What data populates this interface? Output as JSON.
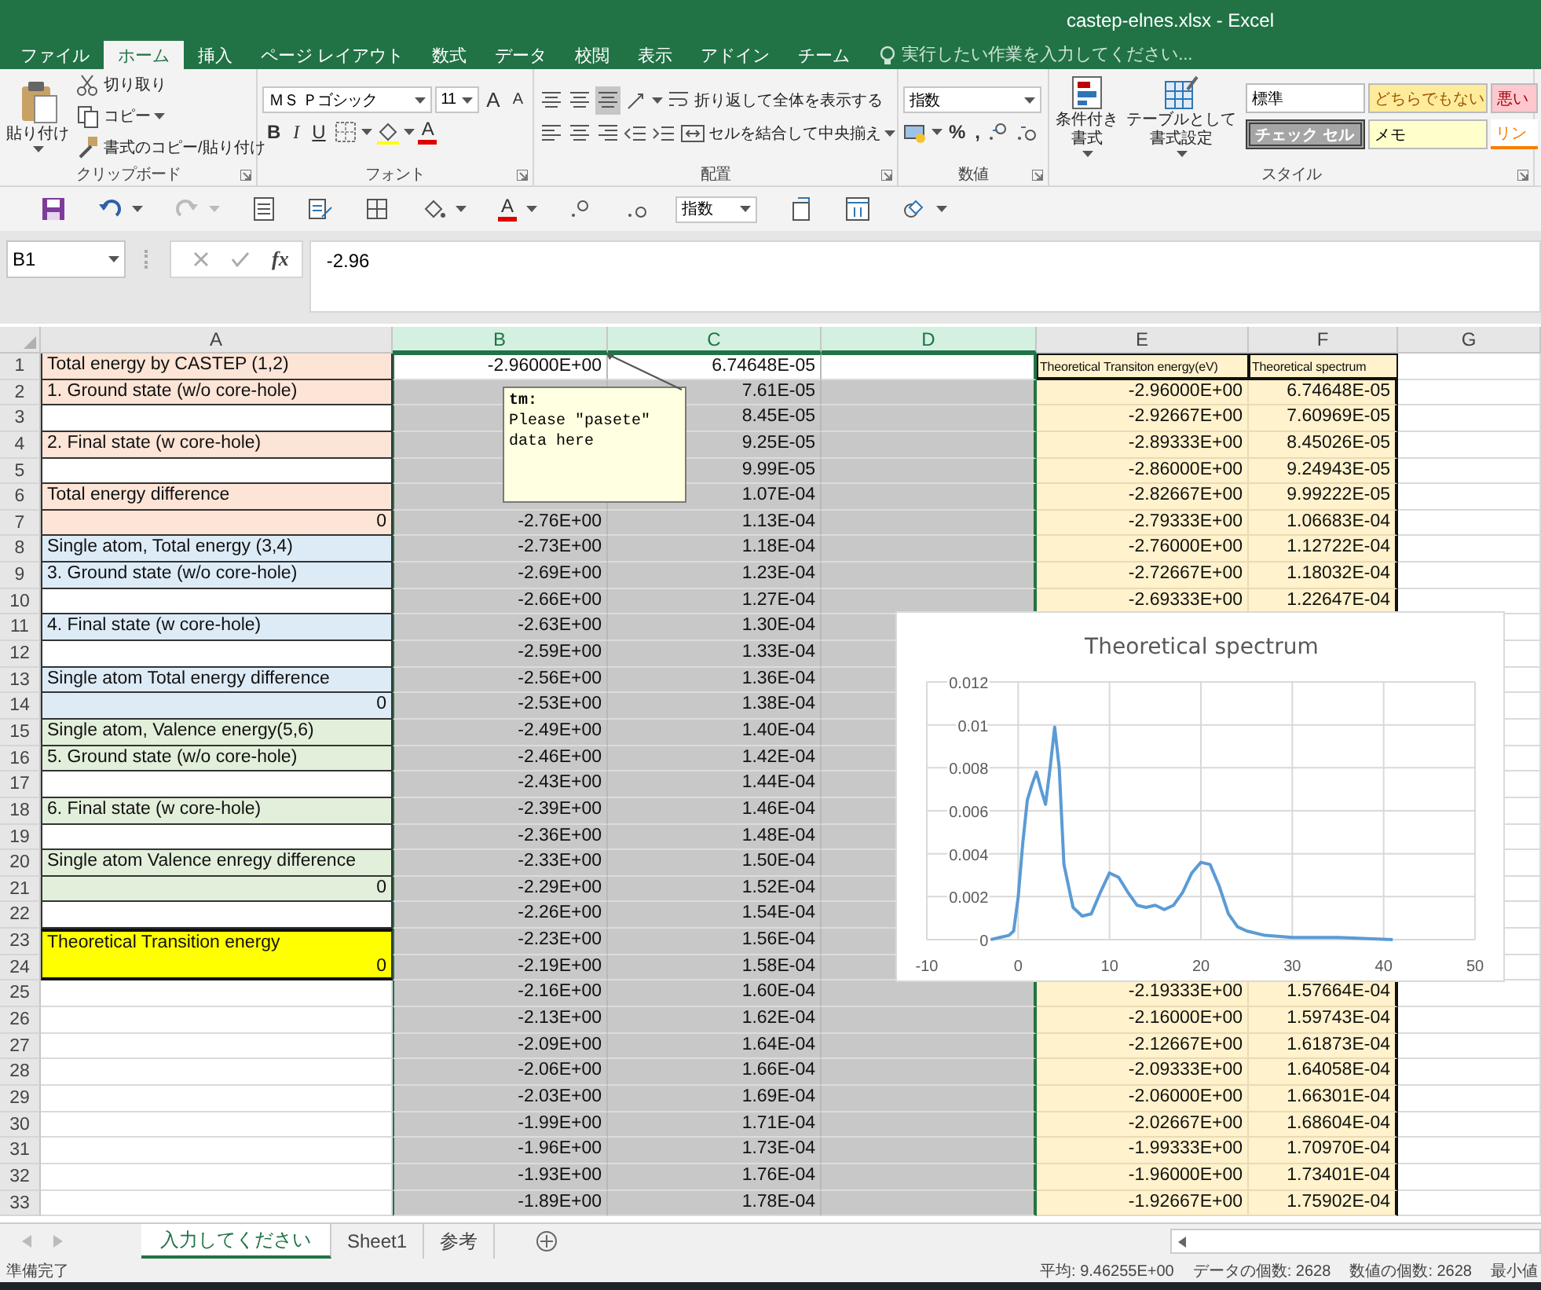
{
  "window": {
    "title": "castep-elnes.xlsx - Excel"
  },
  "ribbon_tabs": [
    {
      "label": "ファイル",
      "selected": false
    },
    {
      "label": "ホーム",
      "selected": true
    },
    {
      "label": "挿入",
      "selected": false
    },
    {
      "label": "ページ レイアウト",
      "selected": false
    },
    {
      "label": "数式",
      "selected": false
    },
    {
      "label": "データ",
      "selected": false
    },
    {
      "label": "校閲",
      "selected": false
    },
    {
      "label": "表示",
      "selected": false
    },
    {
      "label": "アドイン",
      "selected": false
    },
    {
      "label": "チーム",
      "selected": false
    }
  ],
  "tell_me": {
    "placeholder": "実行したい作業を入力してください..."
  },
  "ribbon": {
    "clipboard": {
      "label": "クリップボード",
      "paste": "貼り付け",
      "cut": "切り取り",
      "copy": "コピー",
      "format_painter": "書式のコピー/貼り付け"
    },
    "font": {
      "label": "フォント",
      "name": "ＭＳ Ｐゴシック",
      "size": "11",
      "grow": "A",
      "shrink": "A",
      "bold": "B",
      "italic": "I",
      "underline": "U",
      "font_color": "A"
    },
    "alignment": {
      "label": "配置",
      "wrap": "折り返して全体を表示する",
      "merge": "セルを結合して中央揃え"
    },
    "number": {
      "label": "数値",
      "format": "指数",
      "percent": "%",
      "comma": ","
    },
    "styles": {
      "label": "スタイル",
      "conditional": [
        "条件付き",
        "書式"
      ],
      "table": [
        "テーブルとして",
        "書式設定"
      ],
      "cell_styles": [
        {
          "label": "標準",
          "kind": "normal"
        },
        {
          "label": "どちらでもない",
          "kind": "neutral"
        },
        {
          "label": "悪い",
          "kind": "bad"
        },
        {
          "label": "チェック セル",
          "kind": "check"
        },
        {
          "label": "メモ",
          "kind": "note"
        },
        {
          "label": "リン",
          "kind": "link"
        }
      ]
    }
  },
  "quick_access": {
    "font_color": "A",
    "format": "指数"
  },
  "formula_bar": {
    "name_box": "B1",
    "fx": "fx",
    "value": "-2.96"
  },
  "sheet": {
    "columns": [
      {
        "label": "A",
        "selected": false
      },
      {
        "label": "B",
        "selected": true
      },
      {
        "label": "C",
        "selected": true
      },
      {
        "label": "D",
        "selected": true
      },
      {
        "label": "E",
        "selected": false,
        "color": "#fff2cc"
      },
      {
        "label": "F",
        "selected": false,
        "color": "#fff2cc"
      },
      {
        "label": "G",
        "selected": false
      }
    ],
    "rows": [
      {
        "label": "1",
        "kind": "label",
        "color": "#fce4d6",
        "a": "Total energy by CASTEP (1,2)",
        "b": "-2.96000E+00",
        "c": "6.74648E-05",
        "e": "Theoretical Transiton energy(eV)",
        "f": "Theoretical spectrum",
        "active": true
      },
      {
        "label": "2",
        "kind": "label",
        "color": "#fce4d6",
        "a": "1. Ground state (w/o core-hole)",
        "c": "7.61E-05",
        "e": "-2.96000E+00",
        "f": "6.74648E-05",
        "active": false
      },
      {
        "label": "3",
        "kind": "label",
        "color": "#ffffff",
        "c": "8.45E-05",
        "e": "-2.92667E+00",
        "f": "7.60969E-05",
        "active": false
      },
      {
        "label": "4",
        "kind": "label",
        "color": "#fce4d6",
        "a": "2. Final state (w core-hole)",
        "c": "9.25E-05",
        "e": "-2.89333E+00",
        "f": "8.45026E-05",
        "active": false
      },
      {
        "label": "5",
        "kind": "label",
        "color": "#ffffff",
        "c": "9.99E-05",
        "e": "-2.86000E+00",
        "f": "9.24943E-05",
        "active": false
      },
      {
        "label": "6",
        "kind": "label",
        "color": "#fce4d6",
        "a": "Total energy difference",
        "c": "1.07E-04",
        "e": "-2.82667E+00",
        "f": "9.99222E-05",
        "active": false
      },
      {
        "label": "7",
        "kind": "number",
        "color": "#fce4d6",
        "a": "0",
        "b": "-2.76E+00",
        "c": "1.13E-04",
        "e": "-2.79333E+00",
        "f": "1.06683E-04",
        "active": false
      },
      {
        "label": "8",
        "kind": "label",
        "color": "#ddebf7",
        "a": "Single atom, Total energy (3,4)",
        "b": "-2.73E+00",
        "c": "1.18E-04",
        "e": "-2.76000E+00",
        "f": "1.12722E-04",
        "active": false
      },
      {
        "label": "9",
        "kind": "label",
        "color": "#ddebf7",
        "a": "3. Ground state (w/o core-hole)",
        "b": "-2.69E+00",
        "c": "1.23E-04",
        "e": "-2.72667E+00",
        "f": "1.18032E-04",
        "active": false
      },
      {
        "label": "10",
        "kind": "label",
        "color": "#ffffff",
        "b": "-2.66E+00",
        "c": "1.27E-04",
        "e": "-2.69333E+00",
        "f": "1.22647E-04",
        "active": false
      },
      {
        "label": "11",
        "kind": "label",
        "color": "#ddebf7",
        "a": "4. Final state (w core-hole)",
        "b": "-2.63E+00",
        "c": "1.30E-04",
        "active": false
      },
      {
        "label": "12",
        "kind": "label",
        "color": "#ffffff",
        "b": "-2.59E+00",
        "c": "1.33E-04",
        "active": false
      },
      {
        "label": "13",
        "kind": "label",
        "color": "#ddebf7",
        "a": "Single atom Total energy difference",
        "b": "-2.56E+00",
        "c": "1.36E-04",
        "active": false
      },
      {
        "label": "14",
        "kind": "number",
        "color": "#ddebf7",
        "a": "0",
        "b": "-2.53E+00",
        "c": "1.38E-04",
        "active": false
      },
      {
        "label": "15",
        "kind": "label",
        "color": "#e2efda",
        "a": "Single atom, Valence energy(5,6)",
        "b": "-2.49E+00",
        "c": "1.40E-04",
        "active": false
      },
      {
        "label": "16",
        "kind": "label",
        "color": "#e2efda",
        "a": "5. Ground state (w/o core-hole)",
        "b": "-2.46E+00",
        "c": "1.42E-04",
        "active": false
      },
      {
        "label": "17",
        "kind": "label",
        "color": "#ffffff",
        "b": "-2.43E+00",
        "c": "1.44E-04",
        "active": false
      },
      {
        "label": "18",
        "kind": "label",
        "color": "#e2efda",
        "a": "6. Final state (w core-hole)",
        "b": "-2.39E+00",
        "c": "1.46E-04",
        "active": false
      },
      {
        "label": "19",
        "kind": "label",
        "color": "#ffffff",
        "b": "-2.36E+00",
        "c": "1.48E-04",
        "active": false
      },
      {
        "label": "20",
        "kind": "label",
        "color": "#e2efda",
        "a": "Single atom Valence enregy difference",
        "b": "-2.33E+00",
        "c": "1.50E-04",
        "active": false
      },
      {
        "label": "21",
        "kind": "number",
        "color": "#e2efda",
        "a": "0",
        "b": "-2.29E+00",
        "c": "1.52E-04",
        "active": false
      },
      {
        "label": "22",
        "kind": "label",
        "color": "#ffffff",
        "b": "-2.26E+00",
        "c": "1.54E-04",
        "active": false
      },
      {
        "label": "23",
        "kind": "merged",
        "color": "#ffff00",
        "a": "Theoretical Transition energy",
        "a_value": "0",
        "b": "-2.23E+00",
        "c": "1.56E-04",
        "active": false
      },
      {
        "label": "24",
        "kind": "covered",
        "b": "-2.19E+00",
        "c": "1.58E-04",
        "active": false
      },
      {
        "label": "25",
        "kind": "plain",
        "b": "-2.16E+00",
        "c": "1.60E-04",
        "e": "-2.19333E+00",
        "f": "1.57664E-04",
        "active": false
      },
      {
        "label": "26",
        "kind": "plain",
        "b": "-2.13E+00",
        "c": "1.62E-04",
        "e": "-2.16000E+00",
        "f": "1.59743E-04",
        "active": false
      },
      {
        "label": "27",
        "kind": "plain",
        "b": "-2.09E+00",
        "c": "1.64E-04",
        "e": "-2.12667E+00",
        "f": "1.61873E-04",
        "active": false
      },
      {
        "label": "28",
        "kind": "plain",
        "b": "-2.06E+00",
        "c": "1.66E-04",
        "e": "-2.09333E+00",
        "f": "1.64058E-04",
        "active": false
      },
      {
        "label": "29",
        "kind": "plain",
        "b": "-2.03E+00",
        "c": "1.69E-04",
        "e": "-2.06000E+00",
        "f": "1.66301E-04",
        "active": false
      },
      {
        "label": "30",
        "kind": "plain",
        "b": "-1.99E+00",
        "c": "1.71E-04",
        "e": "-2.02667E+00",
        "f": "1.68604E-04",
        "active": false
      },
      {
        "label": "31",
        "kind": "plain",
        "b": "-1.96E+00",
        "c": "1.73E-04",
        "e": "-1.99333E+00",
        "f": "1.70970E-04",
        "active": false
      },
      {
        "label": "32",
        "kind": "plain",
        "b": "-1.93E+00",
        "c": "1.76E-04",
        "e": "-1.96000E+00",
        "f": "1.73401E-04",
        "active": false
      },
      {
        "label": "33",
        "kind": "plain",
        "b": "-1.89E+00",
        "c": "1.78E-04",
        "e": "-1.92667E+00",
        "f": "1.75902E-04",
        "active": false
      }
    ],
    "comment": {
      "author": "tm:",
      "text": "Please \"pasete\" data here"
    },
    "chart": {
      "chart_data": {
        "type": "line",
        "title": "Theoretical spectrum",
        "grid": true,
        "x": [
          -3,
          -2,
          -1,
          -0.5,
          0,
          0.5,
          1,
          1.5,
          2,
          2.5,
          3,
          3.5,
          4,
          4.5,
          5,
          6,
          7,
          8,
          9,
          10,
          11,
          12,
          13,
          14,
          15,
          16,
          17,
          18,
          19,
          20,
          21,
          22,
          23,
          24,
          25,
          27,
          30,
          35,
          41
        ],
        "series": [
          {
            "color": "#5b9bd5",
            "values": [
              0,
              0.0001,
              0.0002,
              0.0004,
              0.002,
              0.0045,
              0.0065,
              0.0072,
              0.0078,
              0.007,
              0.0063,
              0.008,
              0.0099,
              0.008,
              0.0035,
              0.0015,
              0.0011,
              0.0012,
              0.0022,
              0.0031,
              0.0029,
              0.0022,
              0.0016,
              0.0015,
              0.0016,
              0.0014,
              0.0016,
              0.0022,
              0.0031,
              0.0036,
              0.0035,
              0.0025,
              0.0012,
              0.0006,
              0.0004,
              0.0002,
              0.0001,
              0.0001,
              0
            ]
          }
        ],
        "xlim": [
          -10,
          50
        ],
        "ylim": [
          0,
          0.012
        ],
        "xticks": [
          -10,
          0,
          10,
          20,
          30,
          40,
          50
        ],
        "yticks": [
          0,
          0.002,
          0.004,
          0.006,
          0.008,
          0.01,
          0.012
        ]
      }
    }
  },
  "sheet_tabs": [
    {
      "label": "入力してください",
      "selected": true
    },
    {
      "label": "Sheet1",
      "selected": false
    },
    {
      "label": "参考",
      "selected": false
    }
  ],
  "status_bar": {
    "status": "準備完了",
    "stats": [
      "平均: 9.46255E+00",
      "データの個数: 2628",
      "数値の個数: 2628",
      "最小値"
    ]
  }
}
